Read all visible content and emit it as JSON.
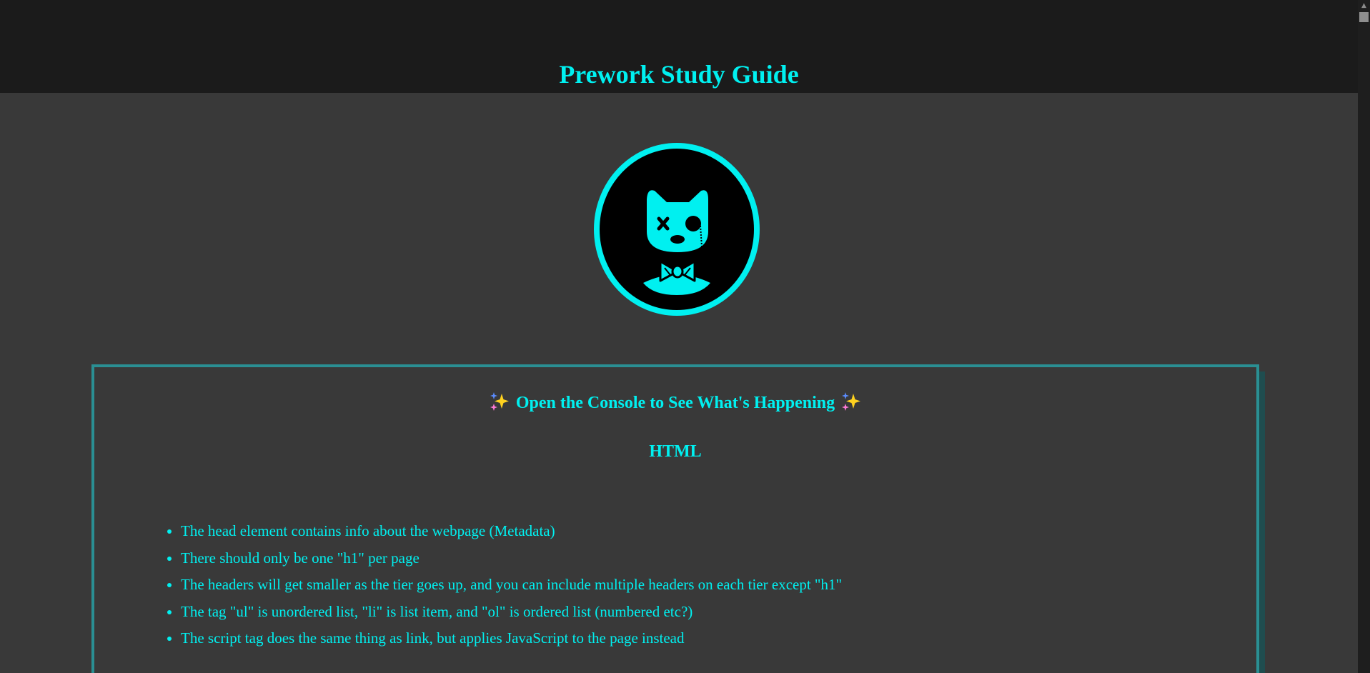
{
  "header": {
    "title": "Prework Study Guide"
  },
  "logo": {
    "icon": "cat-with-monocle-and-bowtie-icon",
    "accent_color": "#00f0f0"
  },
  "card": {
    "heading": "Open the Console to See What's Happening",
    "heading_icon": "sparkles-icon",
    "section_title": "HTML",
    "notes": [
      "The head element contains info about the webpage (Metadata)",
      "There should only be one \"h1\" per page",
      "The headers will get smaller as the tier goes up, and you can include multiple headers on each tier except \"h1\"",
      "The tag \"ul\" is unordered list, \"li\" is list item, and \"ol\" is ordered list (numbered etc?)",
      "The script tag does the same thing as link, but applies JavaScript to the page instead"
    ]
  },
  "colors": {
    "background": "#393939",
    "header_background": "#1b1b1b",
    "text": "#00f0f0",
    "card_border": "#2a8f93"
  }
}
